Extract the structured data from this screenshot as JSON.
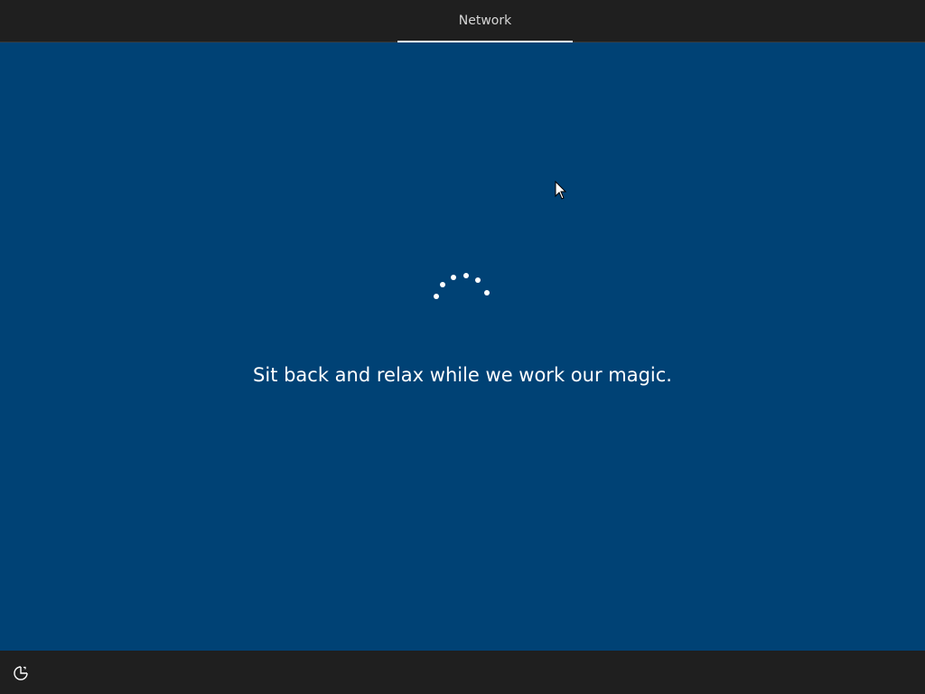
{
  "header": {
    "tabs": [
      {
        "label": "Network",
        "active": true
      }
    ]
  },
  "main": {
    "status_message": "Sit back and relax while we work our magic.",
    "spinner_icon": "loading-dots-icon"
  },
  "footer": {
    "accessibility_icon": "ease-of-access-icon"
  },
  "colors": {
    "background": "#004275",
    "bars": "#1f1f1f",
    "text": "#ffffff",
    "tab_text": "#d6d6d6"
  }
}
